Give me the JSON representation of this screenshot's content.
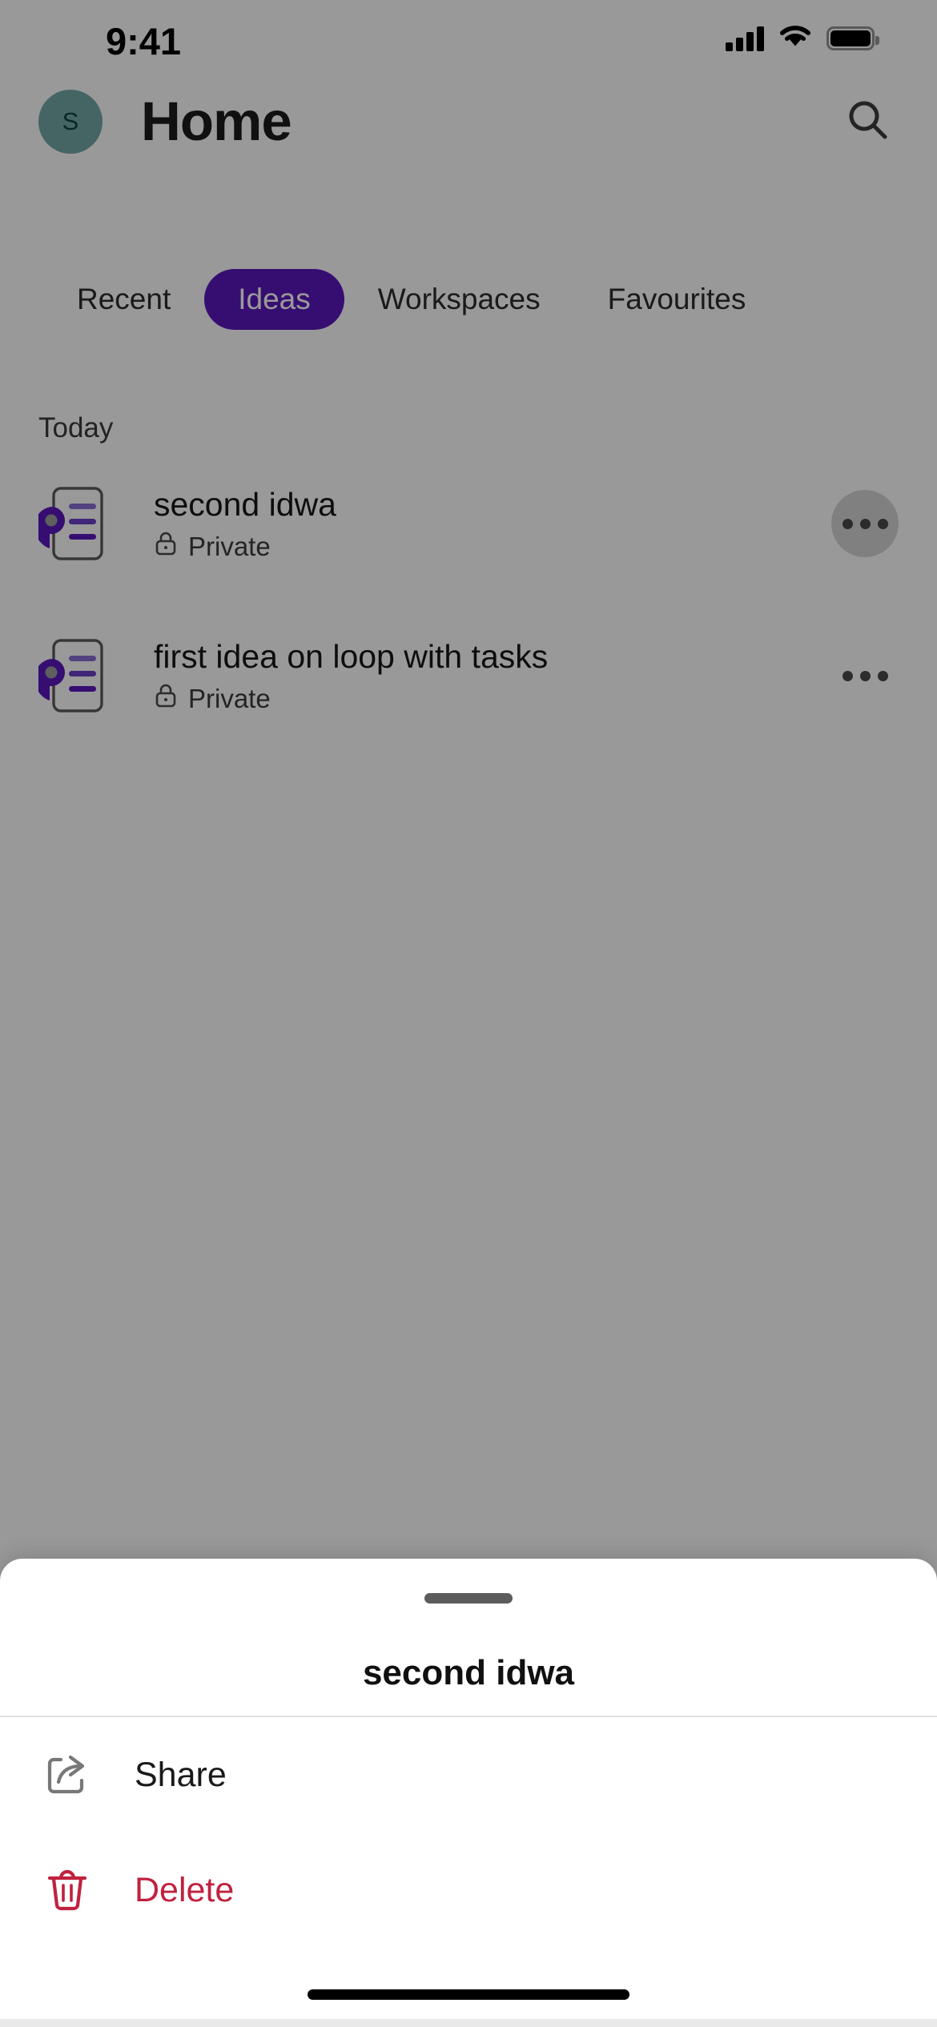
{
  "status_bar": {
    "time": "9:41",
    "icons": [
      "cellular-signal-icon",
      "wifi-icon",
      "battery-icon"
    ]
  },
  "header": {
    "avatar_initial": "S",
    "avatar_color": "#74A8A8",
    "title": "Home",
    "search_icon": "search-icon"
  },
  "tabs": {
    "items": [
      {
        "label": "Recent",
        "selected": false
      },
      {
        "label": "Ideas",
        "selected": true
      },
      {
        "label": "Workspaces",
        "selected": false
      },
      {
        "label": "Favourites",
        "selected": false
      }
    ],
    "selected_color": "#5B18BE"
  },
  "list": {
    "section_header": "Today",
    "items": [
      {
        "name": "second idwa",
        "privacy": "Private",
        "privacy_icon": "lock-icon",
        "doc_icon": "loop-page-icon",
        "more_icon": "more-horizontal-icon",
        "more_pressed": true
      },
      {
        "name": "first idea on loop with tasks",
        "privacy": "Private",
        "privacy_icon": "lock-icon",
        "doc_icon": "loop-page-icon",
        "more_icon": "more-horizontal-icon",
        "more_pressed": false
      }
    ]
  },
  "sheet": {
    "title": "second idwa",
    "handle": "drag-handle",
    "actions": [
      {
        "label": "Share",
        "icon": "share-icon",
        "color": "#191919"
      },
      {
        "label": "Delete",
        "icon": "trash-icon",
        "color": "#C0213F"
      }
    ]
  },
  "system": {
    "home_indicator": "home-indicator"
  }
}
